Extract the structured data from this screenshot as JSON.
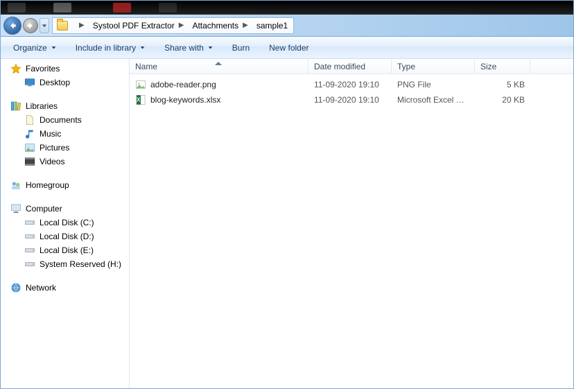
{
  "breadcrumbs": [
    "Systool PDF Extractor",
    "Attachments",
    "sample1"
  ],
  "toolbar": {
    "organize": "Organize",
    "include": "Include in library",
    "share": "Share with",
    "burn": "Burn",
    "newfolder": "New folder"
  },
  "sidebar": {
    "favorites": {
      "label": "Favorites",
      "items": [
        "Desktop"
      ]
    },
    "libraries": {
      "label": "Libraries",
      "items": [
        "Documents",
        "Music",
        "Pictures",
        "Videos"
      ]
    },
    "homegroup": {
      "label": "Homegroup"
    },
    "computer": {
      "label": "Computer",
      "items": [
        "Local Disk (C:)",
        "Local Disk (D:)",
        "Local Disk (E:)",
        "System Reserved (H:)"
      ]
    },
    "network": {
      "label": "Network"
    }
  },
  "columns": {
    "name": "Name",
    "date": "Date modified",
    "type": "Type",
    "size": "Size"
  },
  "files": [
    {
      "name": "adobe-reader.png",
      "date": "11-09-2020 19:10",
      "type": "PNG File",
      "size": "5 KB",
      "icon": "image"
    },
    {
      "name": "blog-keywords.xlsx",
      "date": "11-09-2020 19:10",
      "type": "Microsoft Excel W...",
      "size": "20 KB",
      "icon": "xlsx"
    }
  ]
}
